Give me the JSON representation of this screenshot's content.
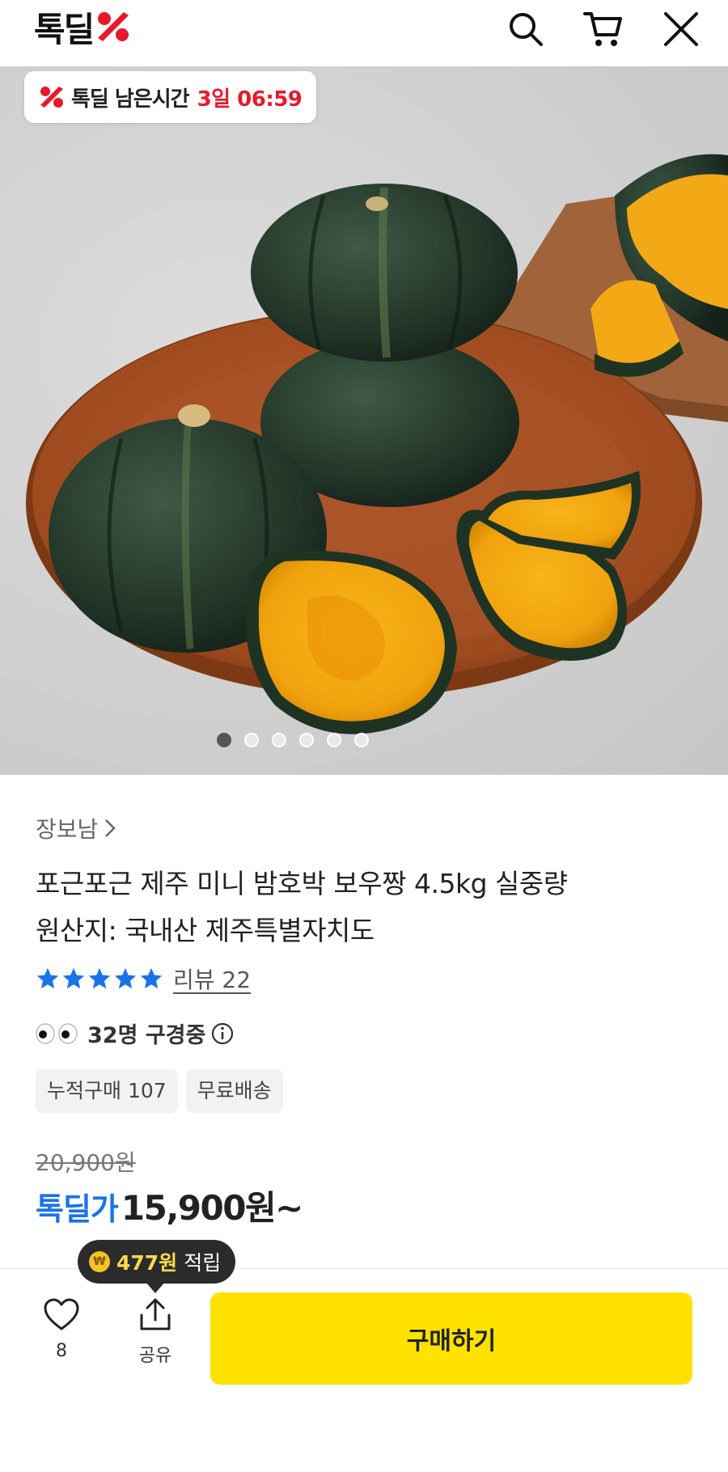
{
  "header": {
    "logo_text": "톡딜",
    "icons": [
      "search-icon",
      "cart-icon",
      "close-icon"
    ]
  },
  "hero": {
    "timer_label": "톡딜 남은시간",
    "timer_value": "3일 06:59",
    "dot_count": 6,
    "active_dot": 0
  },
  "product": {
    "seller": "장보남",
    "title_line1": "포근포근 제주 미니 밤호박 보우짱 4.5kg 실중량",
    "title_line2": "원산지: 국내산 제주특별자치도",
    "rating_stars": 5,
    "review_label": "리뷰 22",
    "viewers": "32명 구경중",
    "tags": [
      "누적구매 107",
      "무료배송"
    ],
    "original_price": "20,900원",
    "price_label": "톡딜가",
    "price": "15,900원~"
  },
  "bottom": {
    "points_amount": "477원",
    "points_suffix": "적립",
    "like_count": "8",
    "share_label": "공유",
    "buy_label": "구매하기"
  },
  "colors": {
    "brand_red": "#e8192c",
    "price_blue": "#1a73e8",
    "buy_yellow": "#ffe200",
    "star_blue": "#1a73e8"
  }
}
